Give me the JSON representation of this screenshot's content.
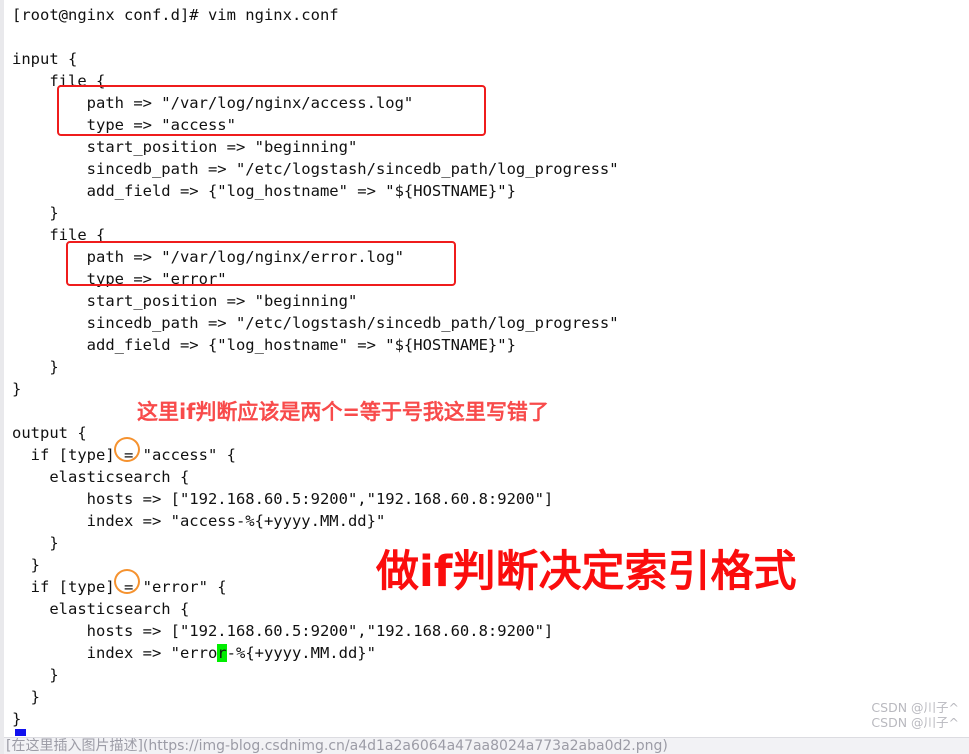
{
  "terminal": {
    "prompt_line": "[root@nginx conf.d]# vim nginx.conf"
  },
  "editor": {
    "filename": "nginx.conf",
    "lines": [
      {
        "id": "blank-1",
        "text": ""
      },
      {
        "id": "input-open",
        "text": "input {"
      },
      {
        "id": "file1-open",
        "text": "    file {"
      },
      {
        "id": "file1-path",
        "text": "        path => \"/var/log/nginx/access.log\""
      },
      {
        "id": "file1-type",
        "text": "        type => \"access\""
      },
      {
        "id": "file1-startpos",
        "text": "        start_position => \"beginning\""
      },
      {
        "id": "file1-sincedb",
        "text": "        sincedb_path => \"/etc/logstash/sincedb_path/log_progress\""
      },
      {
        "id": "file1-addfield",
        "text": "        add_field => {\"log_hostname\" => \"${HOSTNAME}\"}"
      },
      {
        "id": "file1-close",
        "text": "    }"
      },
      {
        "id": "file2-open",
        "text": "    file {"
      },
      {
        "id": "file2-path",
        "text": "        path => \"/var/log/nginx/error.log\""
      },
      {
        "id": "file2-type",
        "text": "        type => \"error\""
      },
      {
        "id": "file2-startpos",
        "text": "        start_position => \"beginning\""
      },
      {
        "id": "file2-sincedb",
        "text": "        sincedb_path => \"/etc/logstash/sincedb_path/log_progress\""
      },
      {
        "id": "file2-addfield",
        "text": "        add_field => {\"log_hostname\" => \"${HOSTNAME}\"}"
      },
      {
        "id": "file2-close",
        "text": "    }"
      },
      {
        "id": "input-close",
        "text": "}"
      },
      {
        "id": "blank-2",
        "text": ""
      },
      {
        "id": "output-open",
        "text": "output {"
      },
      {
        "id": "if-access",
        "text": "  if [type] = \"access\" {"
      },
      {
        "id": "es1-open",
        "text": "    elasticsearch {"
      },
      {
        "id": "es1-hosts",
        "text": "        hosts => [\"192.168.60.5:9200\",\"192.168.60.8:9200\"]"
      },
      {
        "id": "es1-index",
        "text": "        index => \"access-%{+yyyy.MM.dd}\""
      },
      {
        "id": "es1-close",
        "text": "    }"
      },
      {
        "id": "if-access-close",
        "text": "  }"
      },
      {
        "id": "if-error",
        "text": "  if [type] = \"error\" {"
      },
      {
        "id": "es2-open",
        "text": "    elasticsearch {"
      },
      {
        "id": "es2-hosts",
        "text": "        hosts => [\"192.168.60.5:9200\",\"192.168.60.8:9200\"]"
      },
      {
        "id": "es2-index-pre",
        "text": "        index => \"erro"
      },
      {
        "id": "es2-index-cursor",
        "text": "r"
      },
      {
        "id": "es2-index-post",
        "text": "-%{+yyyy.MM.dd}\""
      },
      {
        "id": "es2-close",
        "text": "    }"
      },
      {
        "id": "if-error-close",
        "text": "  }"
      },
      {
        "id": "output-close",
        "text": "}"
      }
    ]
  },
  "annotations": {
    "note_equal_sign": "这里if判断应该是两个=等于号我这里写错了",
    "note_index_format": "做if判断决定索引格式",
    "redbox_access_label": "access file path and type highlight",
    "redbox_error_label": "error file path and type highlight",
    "oval_access_label": "single equals sign on access if",
    "oval_error_label": "single equals sign on error if"
  },
  "watermark": {
    "line1": "CSDN @川子^",
    "line2": "CSDN @川子^"
  },
  "bottom_strip": {
    "cut_text": "[在这里插入图片描述](https://img-blog.csdnimg.cn/a4d1a2a6064a47aa8024a773a2aba0d2.png)"
  },
  "colors": {
    "annotation_red": "#fb0d0d",
    "note_red": "#f84b4b",
    "redbox": "#ef1c1c",
    "oval_orange": "#f5922f",
    "cursor_green": "#00ee00",
    "text": "#111111",
    "watermark": "#b9b9bf",
    "background": "#ffffff"
  }
}
